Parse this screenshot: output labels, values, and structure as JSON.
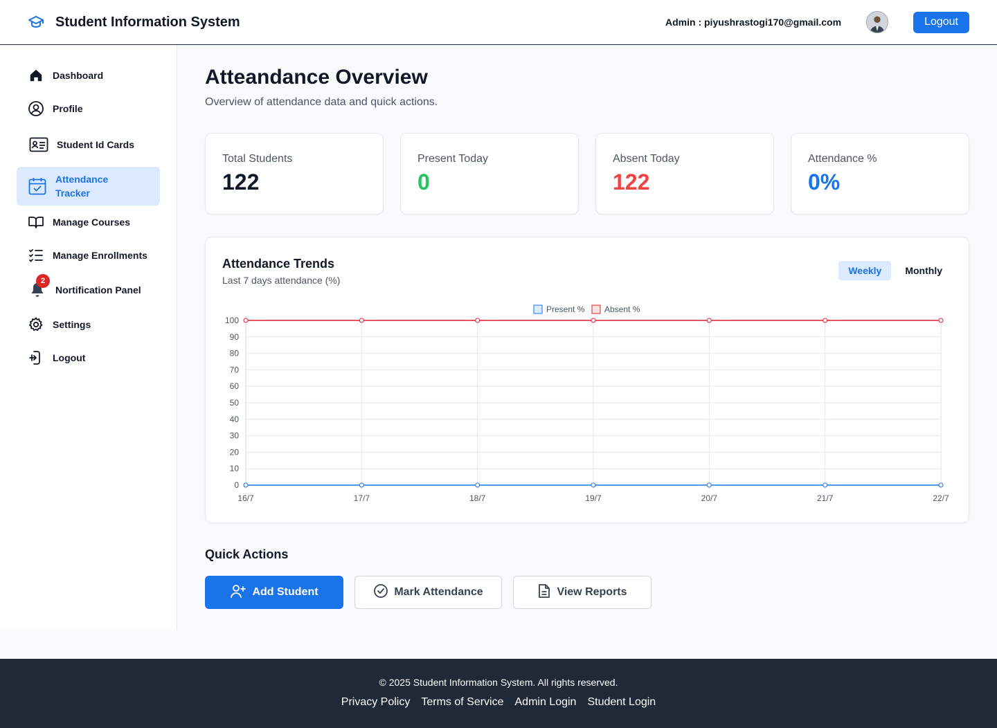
{
  "header": {
    "title": "Student Information System",
    "admin_label": "Admin : piyushrastogi170@gmail.com",
    "logout_label": "Logout"
  },
  "sidebar": {
    "items": [
      {
        "label": "Dashboard",
        "icon": "home-icon"
      },
      {
        "label": "Profile",
        "icon": "user-circle-icon"
      },
      {
        "label": "Student Id Cards",
        "icon": "id-card-icon"
      },
      {
        "label": "Attendance Tracker",
        "icon": "calendar-check-icon",
        "active": true
      },
      {
        "label": "Manage Courses",
        "icon": "book-open-icon"
      },
      {
        "label": "Manage Enrollments",
        "icon": "checklist-icon"
      },
      {
        "label": "Nortification Panel",
        "icon": "bell-icon",
        "badge": "2"
      },
      {
        "label": "Settings",
        "icon": "gear-icon"
      },
      {
        "label": "Logout",
        "icon": "logout-icon"
      }
    ]
  },
  "main": {
    "title": "Atteandance Overview",
    "subtitle": "Overview of attendance data and quick actions.",
    "stats": [
      {
        "label": "Total Students",
        "value": "122",
        "color": "#111827"
      },
      {
        "label": "Present Today",
        "value": "0",
        "color": "#22c55e"
      },
      {
        "label": "Absent Today",
        "value": "122",
        "color": "#ef4444"
      },
      {
        "label": "Attendance %",
        "value": "0%",
        "color": "#1a73e8"
      }
    ],
    "trends": {
      "title": "Attendance Trends",
      "subtitle": "Last 7 days attendance (%)",
      "toggle_weekly": "Weekly",
      "toggle_monthly": "Monthly"
    },
    "quick_actions": {
      "title": "Quick Actions",
      "add_student": "Add Student",
      "mark_attendance": "Mark Attendance",
      "view_reports": "View Reports"
    }
  },
  "chart_data": {
    "type": "line",
    "title": "",
    "xlabel": "",
    "ylabel": "",
    "x": [
      "16/7",
      "17/7",
      "18/7",
      "19/7",
      "20/7",
      "21/7",
      "22/7"
    ],
    "ylim": [
      0,
      100
    ],
    "yticks": [
      0,
      10,
      20,
      30,
      40,
      50,
      60,
      70,
      80,
      90,
      100
    ],
    "grid": true,
    "legend": "top-center",
    "series": [
      {
        "name": "Present %",
        "values": [
          0,
          0,
          0,
          0,
          0,
          0,
          0
        ],
        "color": "#1a73e8"
      },
      {
        "name": "Absent %",
        "values": [
          100,
          100,
          100,
          100,
          100,
          100,
          100
        ],
        "color": "#e11d2a"
      }
    ]
  },
  "footer": {
    "copyright": "© 2025 Student Information System. All rights reserved.",
    "links": [
      "Privacy Policy",
      "Terms of Service",
      "Admin Login",
      "Student Login"
    ]
  }
}
